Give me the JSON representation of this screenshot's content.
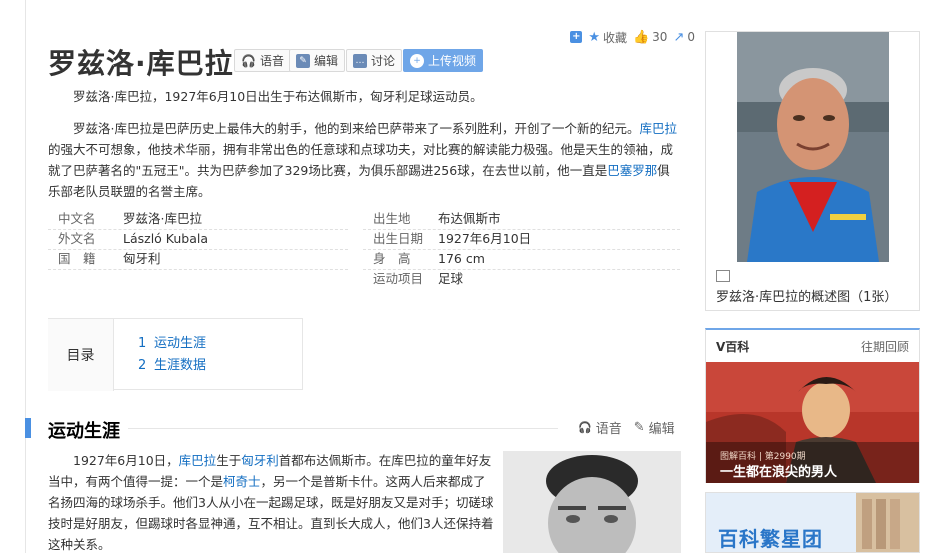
{
  "toolbar": {
    "collect_label": "收藏",
    "like_count": "30",
    "share_count": "0"
  },
  "title": "罗兹洛·库巴拉",
  "title_buttons": {
    "voice": "语音",
    "edit": "编辑",
    "discuss": "讨论",
    "upload": "上传视频"
  },
  "summary": "罗兹洛·库巴拉，1927年6月10日出生于布达佩斯市，匈牙利足球运动员。",
  "intro": {
    "p1": "罗兹洛·库巴拉是巴萨历史上最伟大的射手，他的到来给巴萨带来了一系列胜利，开创了一个新的纪元。",
    "link_kubala": "库巴拉",
    "p2": "的强大不可想象，他技术华丽，拥有非常出色的任意球和点球功夫，对比赛的解读能力极强。他是天生的领袖，成就了巴萨著名的\"五冠王\"。共为巴萨参加了329场比赛，为俱乐部踢进256球，在去世以前，他一直是",
    "link_barca": "巴塞罗那",
    "p3": "俱乐部老队员联盟的名誉主席。"
  },
  "basic_info": {
    "left": [
      {
        "key": "中文名",
        "value": "罗兹洛·库巴拉"
      },
      {
        "key": "外文名",
        "value": "László Kubala"
      },
      {
        "key": "国　籍",
        "value": "匈牙利"
      }
    ],
    "right": [
      {
        "key": "出生地",
        "value": "布达佩斯市"
      },
      {
        "key": "出生日期",
        "value": "1927年6月10日"
      },
      {
        "key": "身　高",
        "value": "176 cm"
      },
      {
        "key": "运动项目",
        "value": "足球"
      }
    ]
  },
  "catalog": {
    "title": "目录",
    "items": [
      {
        "num": "1",
        "label": "运动生涯"
      },
      {
        "num": "2",
        "label": "生涯数据"
      }
    ]
  },
  "section": {
    "title": "运动生涯",
    "voice": "语音",
    "edit": "编辑",
    "t1": "1927年6月10日，",
    "link1": "库巴拉",
    "t2": "生于",
    "link2": "匈牙利",
    "t3": "首都布达佩斯市。在库巴拉的童年好友当中，有两个值得一提：一个是",
    "link3": "柯奇士",
    "t4": "，另一个是普斯卡什。这两人后来都成了名扬四海的球场杀手。他们3人从小在一起踢足球，既是好朋友又是对手；切磋球技时是好朋友，但踢球时各显神通，互不相让。直到长大成人，他们3人还保持着这种关系。"
  },
  "album": {
    "caption": "罗兹洛·库巴拉的概述图（1张）"
  },
  "vbox": {
    "title": "V百科",
    "more": "往期回顾",
    "tag": "图解百科 | 第2990期",
    "caption": "一生都在浪尖的男人"
  },
  "star": {
    "text": "百科繁星团"
  },
  "colors": {
    "link": "#136ec2",
    "accent": "#4a90e2"
  }
}
